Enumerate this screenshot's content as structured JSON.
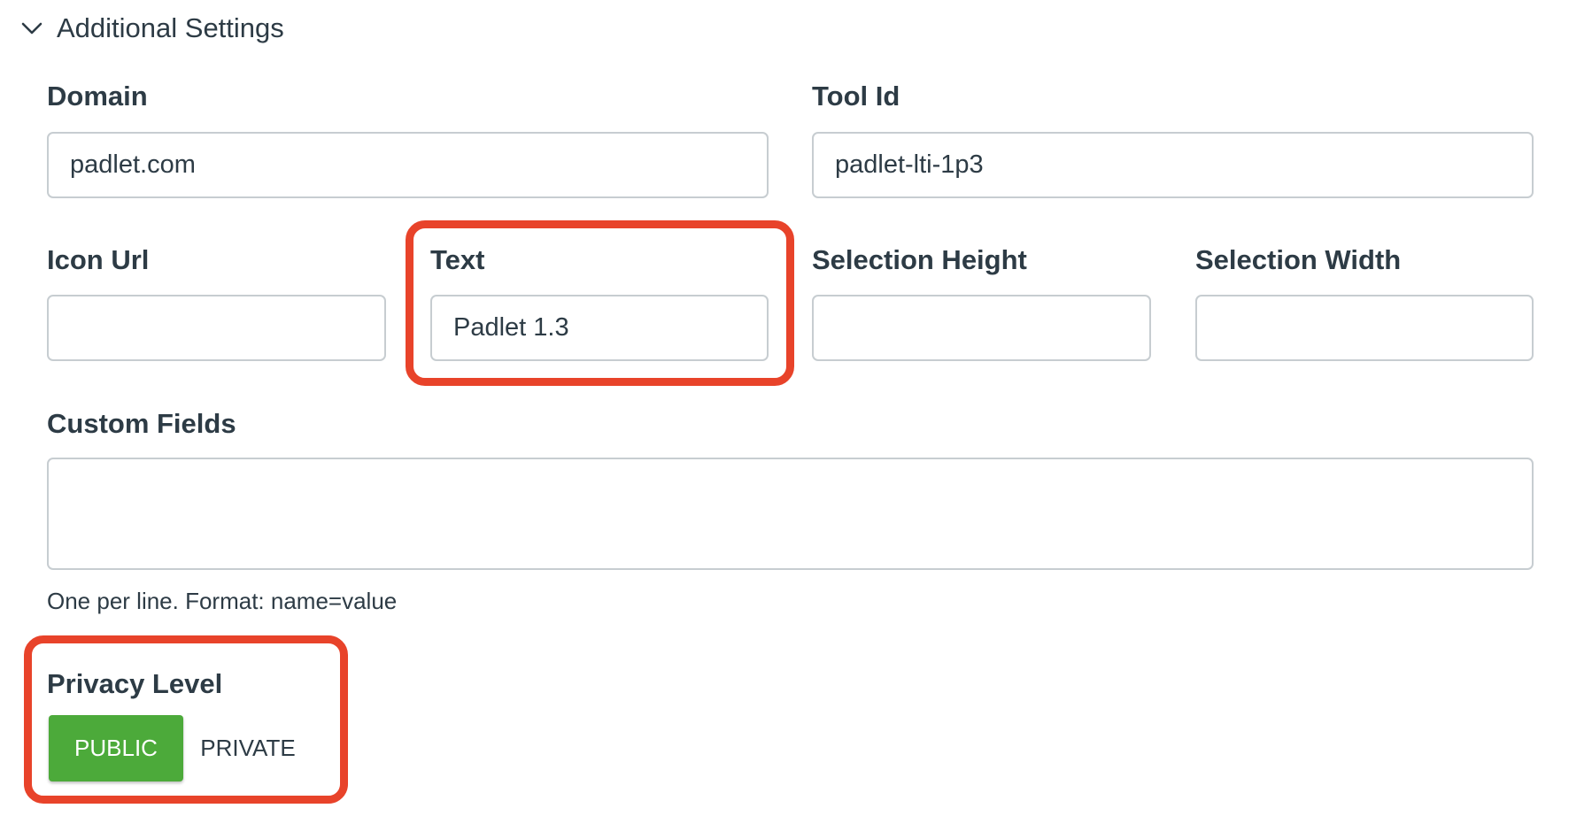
{
  "section": {
    "title": "Additional Settings",
    "expanded": true,
    "toggle_icon": "chevron-down-icon"
  },
  "fields": {
    "domain": {
      "label": "Domain",
      "value": "padlet.com"
    },
    "tool_id": {
      "label": "Tool Id",
      "value": "padlet-lti-1p3"
    },
    "icon_url": {
      "label": "Icon Url",
      "value": ""
    },
    "text": {
      "label": "Text",
      "value": "Padlet 1.3"
    },
    "selection_height": {
      "label": "Selection Height",
      "value": ""
    },
    "selection_width": {
      "label": "Selection Width",
      "value": ""
    },
    "custom_fields": {
      "label": "Custom Fields",
      "value": "",
      "hint": "One per line. Format: name=value"
    }
  },
  "privacy": {
    "label": "Privacy Level",
    "options": [
      {
        "label": "PUBLIC",
        "selected": true
      },
      {
        "label": "PRIVATE",
        "selected": false
      }
    ],
    "selected_color": "#4caa3a"
  },
  "annotations": {
    "highlight_color": "#e8432a",
    "highlighted": [
      "text",
      "privacy"
    ]
  }
}
